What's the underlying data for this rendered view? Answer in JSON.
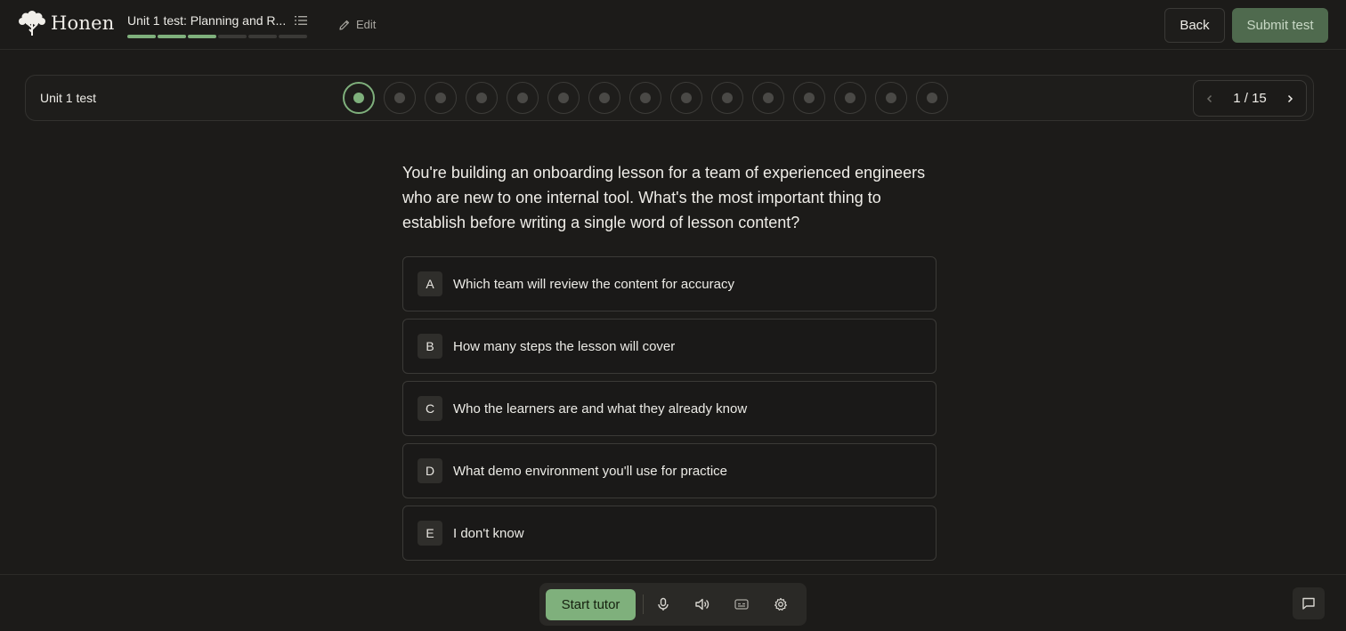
{
  "app": {
    "name": "Honen"
  },
  "header": {
    "course_title": "Unit 1 test: Planning and R...",
    "progress_segments": [
      true,
      true,
      true,
      false,
      false,
      false
    ],
    "edit_label": "Edit",
    "back_label": "Back",
    "submit_label": "Submit test"
  },
  "test_nav": {
    "title": "Unit 1 test",
    "total_questions": 15,
    "current_question": 1,
    "pager_text": "1 / 15"
  },
  "question": {
    "text": "You're building an onboarding lesson for a team of experienced engineers who are new to one internal tool. What's the most important thing to establish before writing a single word of lesson content?",
    "options": [
      {
        "letter": "A",
        "text": "Which team will review the content for accuracy"
      },
      {
        "letter": "B",
        "text": "How many steps the lesson will cover"
      },
      {
        "letter": "C",
        "text": "Who the learners are and what they already know"
      },
      {
        "letter": "D",
        "text": "What demo environment you'll use for practice"
      },
      {
        "letter": "E",
        "text": "I don't know"
      }
    ]
  },
  "bottom_bar": {
    "start_tutor_label": "Start tutor",
    "tools": [
      "microphone-icon",
      "speaker-icon",
      "captions-icon",
      "settings-icon"
    ],
    "chat_icon": "chat-icon"
  },
  "colors": {
    "background": "#1c1b19",
    "accent": "#7fb07c",
    "submit_bg": "#4f6a4e"
  }
}
